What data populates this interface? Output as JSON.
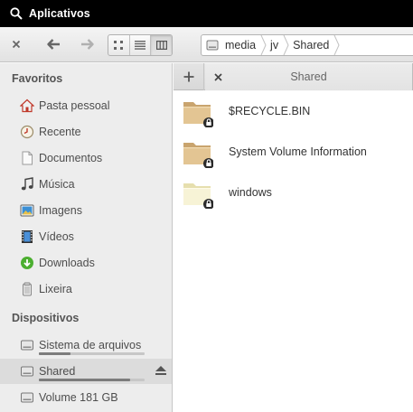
{
  "top_panel": {
    "apps_label": "Aplicativos"
  },
  "pathbar": {
    "crumbs": [
      "media",
      "jv",
      "Shared"
    ]
  },
  "sidebar": {
    "favorites_title": "Favoritos",
    "favorites": [
      {
        "label": "Pasta pessoal",
        "icon": "home-icon"
      },
      {
        "label": "Recente",
        "icon": "recent-icon"
      },
      {
        "label": "Documentos",
        "icon": "documents-icon"
      },
      {
        "label": "Música",
        "icon": "music-icon"
      },
      {
        "label": "Imagens",
        "icon": "images-icon"
      },
      {
        "label": "Vídeos",
        "icon": "videos-icon"
      },
      {
        "label": "Downloads",
        "icon": "downloads-icon"
      },
      {
        "label": "Lixeira",
        "icon": "trash-icon"
      }
    ],
    "devices_title": "Dispositivos",
    "devices": [
      {
        "label": "Sistema de arquivos",
        "icon": "drive-icon",
        "usage": 0.3
      },
      {
        "label": "Shared",
        "icon": "drive-icon",
        "usage": 0.86
      },
      {
        "label": "Volume 181 GB",
        "icon": "drive-icon"
      }
    ]
  },
  "tabs": [
    {
      "label": "Shared"
    }
  ],
  "files": [
    {
      "name": "$RECYCLE.BIN",
      "icon": "locked-folder-icon"
    },
    {
      "name": "System Volume Information",
      "icon": "locked-folder-icon"
    },
    {
      "name": "windows",
      "icon": "locked-folder-icon"
    }
  ]
}
